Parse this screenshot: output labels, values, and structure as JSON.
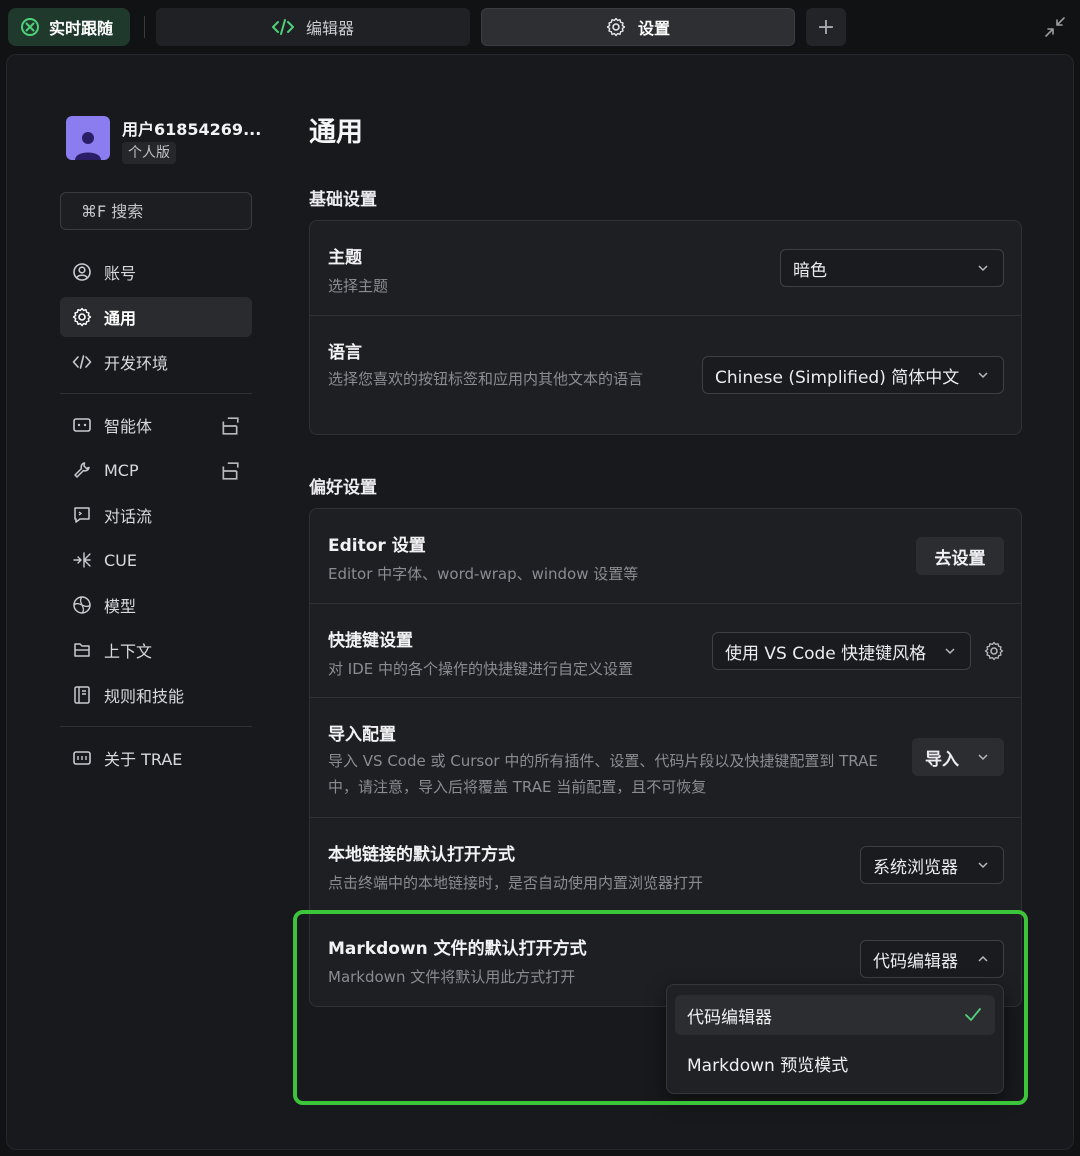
{
  "topbar": {
    "live_tab": "实时跟随",
    "editor_tab": "编辑器",
    "settings_tab": "设置",
    "add_tab": "+"
  },
  "user": {
    "name": "用户61854269...",
    "plan": "个人版"
  },
  "sidebar": {
    "search_placeholder": "⌘F 搜索",
    "items": [
      {
        "label": "账号",
        "icon": "user-icon"
      },
      {
        "label": "通用",
        "icon": "gear-icon",
        "active": true
      },
      {
        "label": "开发环境",
        "icon": "code-icon"
      },
      {
        "label": "智能体",
        "icon": "bot-icon",
        "external": true
      },
      {
        "label": "MCP",
        "icon": "wrench-icon",
        "external": true
      },
      {
        "label": "对话流",
        "icon": "chat-icon"
      },
      {
        "label": "CUE",
        "icon": "cue-icon"
      },
      {
        "label": "模型",
        "icon": "model-icon"
      },
      {
        "label": "上下文",
        "icon": "context-icon"
      },
      {
        "label": "规则和技能",
        "icon": "rules-icon"
      },
      {
        "label": "关于 TRAE",
        "icon": "about-icon"
      }
    ]
  },
  "main": {
    "title": "通用",
    "basic": {
      "section_title": "基础设置",
      "theme": {
        "title": "主题",
        "desc": "选择主题",
        "value": "暗色"
      },
      "language": {
        "title": "语言",
        "desc": "选择您喜欢的按钮标签和应用内其他文本的语言",
        "value": "Chinese (Simplified) 简体中文"
      }
    },
    "prefs": {
      "section_title": "偏好设置",
      "editor": {
        "title": "Editor 设置",
        "desc": "Editor 中字体、word-wrap、window 设置等",
        "button": "去设置"
      },
      "keybinding": {
        "title": "快捷键设置",
        "desc": "对 IDE 中的各个操作的快捷键进行自定义设置",
        "value": "使用 VS Code 快捷键风格"
      },
      "import": {
        "title": "导入配置",
        "desc": "导入 VS Code 或 Cursor 中的所有插件、设置、代码片段以及快捷键配置到 TRAE 中，请注意，导入后将覆盖 TRAE 当前配置，且不可恢复",
        "button": "导入"
      },
      "local_link": {
        "title": "本地链接的默认打开方式",
        "desc": "点击终端中的本地链接时，是否自动使用内置浏览器打开",
        "value": "系统浏览器"
      },
      "markdown": {
        "title": "Markdown 文件的默认打开方式",
        "desc": "Markdown 文件将默认用此方式打开",
        "value": "代码编辑器"
      }
    },
    "markdown_menu": {
      "options": [
        "代码编辑器",
        "Markdown 预览模式"
      ],
      "selected": "代码编辑器"
    }
  },
  "colors": {
    "highlight": "#3cc43a",
    "avatar": "#8b7cf0",
    "live_tab_bg": "#1f3a2c"
  }
}
